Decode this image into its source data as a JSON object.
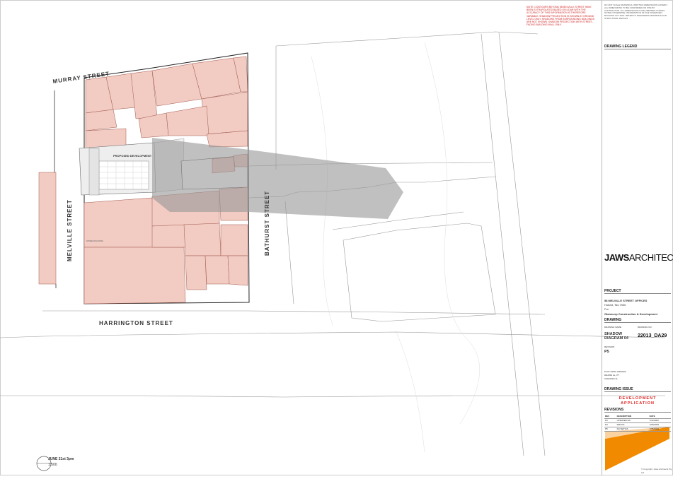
{
  "title_block": {
    "red_note": "NOTE: CONTOURS BEYOND 58 MELVILLE STREET HAVE BEEN EXTRAPOLATED BASED ON LIDAR WITH THE ACCURACY OF THIS INFORMATION IS THEREFORE VARIABLE. SHADOW PROJECTION IS SHOWN AT GROUND LEVEL ONLY. SHADOWS FROM SURROUNDING BUILDINGS ARE NOT SHOWN. SHADOW PROJECTION WITH STREET-FACING BUILDING WALL ONLY.",
    "general_notes": "DO NOT SCALE DRAWINGS. WRITTEN DIMENSIONS GOVERN. ALL DIMENSIONS TO BE CONFIRMED ON SITE BY CONTRACTOR. ALL DIMENSIONS IN MILLIMETRES UNLESS NOTED OTHERWISE. INFORMATION OF THE TASMANIAN BUILDING ACT 2016. REFER TO ENGINEERS DRAWINGS FOR STRUCTURAL DETAILS.",
    "legend_heading": "DRAWING LEGEND",
    "logo_bold": "JAWS",
    "logo_light": "ARCHITECTS",
    "project_heading": "PROJECT",
    "project_name": "58 MELVILLE STREET OFFICES",
    "project_location": "Hobart, Tas 7000",
    "project_for": "For",
    "client": "Glamcorp Construction & Development",
    "drawing_heading": "DRAWING",
    "drawing_name_label": "DRAWING NAME",
    "drawing_no_label": "DRAWING NO.",
    "drawing_name": "SHADOW DIAGRAM 04",
    "drawing_no": "22013_DA29",
    "revision_label": "REVISION",
    "revision": "P5",
    "plot_date": "PLOT DATE 1/05/2023",
    "drawn": "DRAWN AL, PT",
    "checked": "CHECKED AL",
    "issue_heading": "DRAWING ISSUE",
    "issue_line1": "DEVELOPMENT",
    "issue_line2": "APPLICATION",
    "revisions_heading": "REVISIONS",
    "rev_columns": [
      "REV",
      "DESCRIPTION",
      "DATE"
    ],
    "rev_rows": [
      [
        "P3",
        "UPDATED DA",
        "7/11/2022"
      ],
      [
        "P4",
        "RI/P DA",
        "1/03/2023"
      ],
      [
        "P5",
        "DA SEP DA",
        "1/05/2023"
      ]
    ],
    "copyright": "© Copyright: Jaws Architects Pty Ltd"
  },
  "streets": {
    "murray": "MURRAY STREET",
    "melville": "MELVILLE STREET",
    "bathurst": "BATHURST STREET",
    "harrington": "HARRINGTON STREET"
  },
  "site_labels": {
    "proposed": "PROPOSED DEVELOPMENT",
    "spire": "SPIRE BUILDING"
  },
  "scale": {
    "time": "JUNE 21st 3pm",
    "ratio": "1:500"
  },
  "colors": {
    "building_fill": "#f2cbc2",
    "building_edge": "#a05a4e",
    "shadow": "#9a9a9a",
    "accent_orange": "#f28a00",
    "issue_red": "#e02020"
  }
}
